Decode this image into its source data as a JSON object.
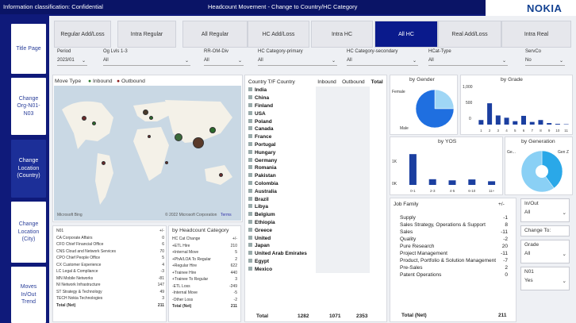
{
  "header": {
    "classification": "Information classification: Confidential",
    "title": "Headcount Movement - Change to Country/HC Category",
    "logo": "NOKIA"
  },
  "nav": [
    {
      "label": "Title Page"
    },
    {
      "label": "Change Org-N01-N03"
    },
    {
      "label": "Change Location (Country)"
    },
    {
      "label": "Change Location (City)"
    },
    {
      "label": "Moves In/Out Trend"
    }
  ],
  "tabs": [
    {
      "label": "Regular Add/Loss"
    },
    {
      "label": "Intra Regular"
    },
    {
      "label": "All Regular"
    },
    {
      "label": "HC Add/Loss"
    },
    {
      "label": "Intra HC"
    },
    {
      "label": "All HC"
    },
    {
      "label": "Real Add/Loss"
    },
    {
      "label": "Intra Real"
    }
  ],
  "filters": [
    {
      "label": "Period",
      "value": "2023/01"
    },
    {
      "label": "Og Lvls 1-3",
      "value": "All"
    },
    {
      "label": "RR-OM-Div",
      "value": "All"
    },
    {
      "label": "HC Category-primary",
      "value": "All"
    },
    {
      "label": "HC Category-secondary",
      "value": "All"
    },
    {
      "label": "HCat-Type",
      "value": "All"
    },
    {
      "label": "ServCo",
      "value": "No"
    }
  ],
  "map": {
    "title": "Move Type",
    "legend_inbound": "Inbound",
    "legend_outbound": "Outbound",
    "brand": "Microsoft Bing",
    "copyright": "© 2022 Microsoft Corporation",
    "terms": "Terms"
  },
  "country_table": {
    "headers": [
      "Country T/F Country",
      "Inbound",
      "Outbound",
      "Total"
    ],
    "rows": [
      "India",
      "China",
      "Finland",
      "USA",
      "Poland",
      "Canada",
      "France",
      "Portugal",
      "Hungary",
      "Germany",
      "Romania",
      "Pakistan",
      "Colombia",
      "Australia",
      "Brazil",
      "Libya",
      "Belgium",
      "Ethiopia",
      "Greece",
      "United",
      "Japan",
      "United Arab Emirates",
      "Egypt",
      "Mexico"
    ],
    "total": {
      "label": "Total",
      "inbound": "1282",
      "outbound": "1071",
      "total": "2353"
    }
  },
  "n01_table": {
    "header": "N01",
    "col": "+/-",
    "rows": [
      {
        "label": "CA Corporate Affairs",
        "v": "0"
      },
      {
        "label": "CFO Chief Financial Office",
        "v": "6"
      },
      {
        "label": "CNS Cloud and Network Services",
        "v": "70"
      },
      {
        "label": "CPO Chief People Office",
        "v": "5"
      },
      {
        "label": "CX Customer Experience",
        "v": "4"
      },
      {
        "label": "LC Legal & Compliance",
        "v": "-3"
      },
      {
        "label": "MN Mobile Networks",
        "v": "-81"
      },
      {
        "label": "NI Network Infrastructure",
        "v": "147"
      },
      {
        "label": "ST Strategy & Technology",
        "v": "49"
      },
      {
        "label": "TECH Nokia Technologies",
        "v": "3"
      }
    ],
    "total": {
      "label": "Total (Net)",
      "v": "211"
    }
  },
  "hc_cat": {
    "title": "by Headcount Category",
    "header": "HC Cat Change",
    "col": "+/-",
    "rows": [
      {
        "label": "+ETL Hire",
        "v": "210"
      },
      {
        "label": "+Internal Move",
        "v": "5"
      },
      {
        "label": "+PhA/LOA To Regular",
        "v": "2"
      },
      {
        "label": "+Regular Hire",
        "v": "622"
      },
      {
        "label": "+Trainee Hire",
        "v": "440"
      },
      {
        "label": "+Trainee To Regular",
        "v": "3"
      },
      {
        "label": "-ETL Loss",
        "v": "-249"
      },
      {
        "label": "-Internal Move",
        "v": "-5"
      },
      {
        "label": "-Other Loss",
        "v": "-2"
      }
    ],
    "total": {
      "label": "Total (Net)",
      "v": "211"
    }
  },
  "gender": {
    "title": "by Gender",
    "female": "Female",
    "male": "Male"
  },
  "grade": {
    "title": "by Grade",
    "ticks": [
      "1,000",
      "500",
      "0"
    ]
  },
  "yos": {
    "title": "by YOS",
    "ticks": [
      "1K",
      "0K"
    ],
    "cats": [
      "0-1",
      "2-3",
      "4-5",
      "6-10",
      "11+"
    ]
  },
  "generation": {
    "title": "by Generation",
    "a": "Ge...",
    "b": "Gen Z"
  },
  "job_family": {
    "header": "Job Family",
    "col": "+/-",
    "rows": [
      {
        "label": "Supply",
        "v": "-1"
      },
      {
        "label": "Sales Strategy, Operations & Support",
        "v": "8"
      },
      {
        "label": "Sales",
        "v": "-11"
      },
      {
        "label": "Quality",
        "v": "-2"
      },
      {
        "label": "Pure Research",
        "v": "20"
      },
      {
        "label": "Project Management",
        "v": "-11"
      },
      {
        "label": "Product, Portfolio & Solution Management",
        "v": "-7"
      },
      {
        "label": "Pre-Sales",
        "v": "2"
      },
      {
        "label": "Patent Operations",
        "v": "0"
      }
    ],
    "total": {
      "label": "Total (Net)",
      "v": "211"
    }
  },
  "right_filters": {
    "inout_label": "In/Out",
    "inout_value": "All",
    "change_to": "Change To:",
    "grade_label": "Grade",
    "grade_value": "All",
    "n01_label": "N01",
    "n01_value": "Yes"
  },
  "chart_data": [
    {
      "type": "bar",
      "title": "by Grade",
      "categories": [
        "1",
        "2",
        "3",
        "4",
        "5",
        "6",
        "7",
        "8",
        "9",
        "10",
        "11"
      ],
      "values": [
        120,
        560,
        240,
        180,
        90,
        230,
        70,
        120,
        40,
        20,
        10
      ],
      "ylim": [
        0,
        1000
      ]
    },
    {
      "type": "bar",
      "title": "by YOS",
      "categories": [
        "0-1",
        "2-3",
        "4-5",
        "6-10",
        "11+"
      ],
      "values": [
        1350,
        250,
        200,
        240,
        160
      ],
      "ylim": [
        0,
        1600
      ]
    },
    {
      "type": "pie",
      "title": "by Gender",
      "categories": [
        "Female",
        "Male"
      ],
      "values": [
        25,
        75
      ]
    },
    {
      "type": "pie",
      "title": "by Generation",
      "categories": [
        "Gen Z",
        "Ge..."
      ],
      "values": [
        40,
        60
      ]
    }
  ]
}
